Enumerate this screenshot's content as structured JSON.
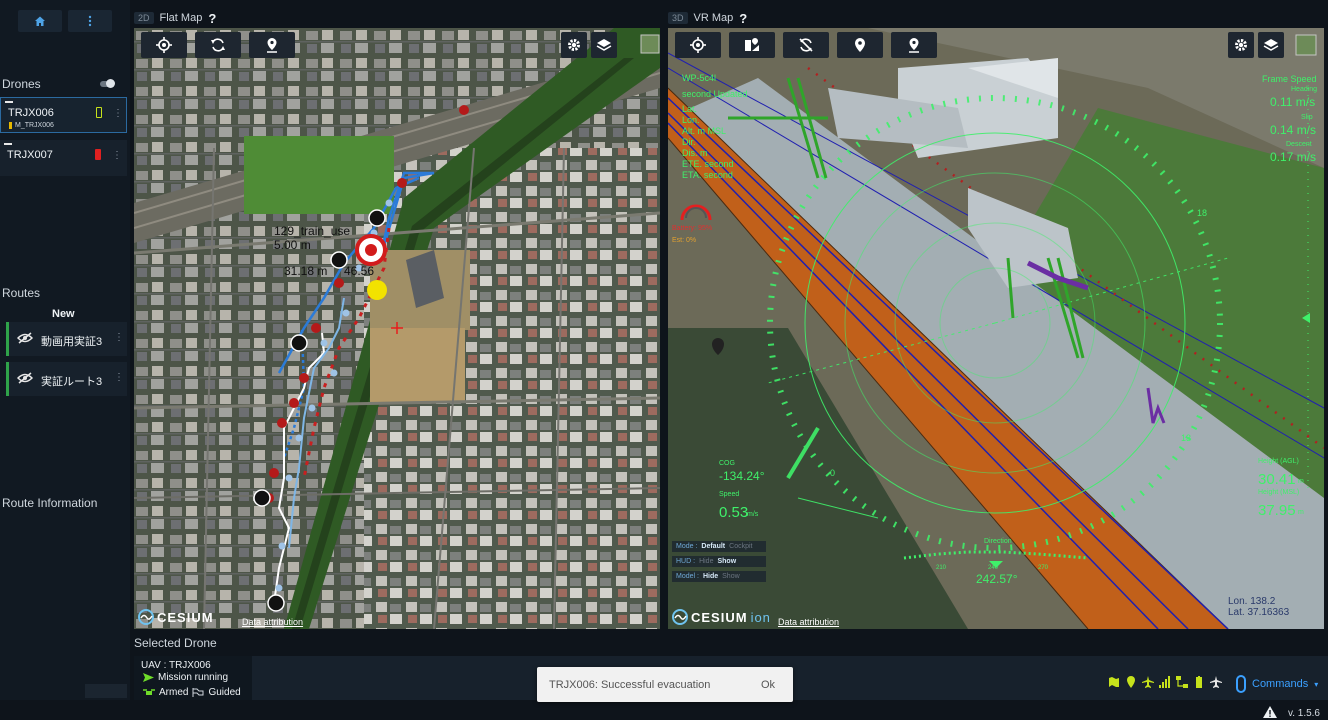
{
  "sidebar": {
    "drones_title": "Drones",
    "drones": [
      {
        "name": "TRJX006",
        "sub": "M_TRJX006",
        "battery_color": "#c6e21b",
        "selected": true
      },
      {
        "name": "TRJX007",
        "sub": "",
        "battery_color": "#e02020",
        "selected": false
      }
    ],
    "routes_title": "Routes",
    "new_label": "New",
    "routes": [
      {
        "name": "動画用実証3"
      },
      {
        "name": "実証ルート3"
      }
    ],
    "route_info_title": "Route Information"
  },
  "flat_map": {
    "tag": "2D",
    "title": "Flat Map",
    "help": "?",
    "overlay_label_1": "129_train_use",
    "overlay_label_2": "5.00 m",
    "overlay_label_3": "31.18 m",
    "overlay_label_4": "46.56",
    "cesium": "CESIUM",
    "attribution": "Data attribution"
  },
  "vr_map": {
    "tag": "3D",
    "title": "VR Map",
    "help": "?",
    "cesium": "CESIUM",
    "cesium_ion": "ion",
    "attribution": "Data attribution",
    "hud": {
      "wp": "WP-5c4l",
      "updated": "second Updated",
      "fields": [
        "Lat.",
        "Lon.",
        "Alt. m MSL",
        "Dir.",
        "Dis. m",
        "ETE. second",
        "ETA. second"
      ],
      "battery": "Battery: 95%",
      "est": "Est: 0%",
      "frame_speed_label": "Frame Speed",
      "heading_label": "Heading",
      "heading_value": "0.11 m/s",
      "slip_label": "Slip",
      "slip_value": "0.14 m/s",
      "descent_label": "Descent",
      "descent_value": "0.17 m/s",
      "cog_label": "COG",
      "cog_value": "-134.24°",
      "speed_label": "Speed",
      "speed_value": "0.53",
      "speed_unit": "m/s",
      "height_agl_label": "Height (AGL)",
      "height_agl_value": "30.41",
      "height_agl_unit": "m",
      "height_msl_label": "Height (MSL)",
      "height_msl_value": "37.95",
      "height_msl_unit": "m",
      "direction_label": "Direction",
      "direction_value": "242.57°",
      "dir_tick_1": "210",
      "dir_tick_2": "240",
      "dir_tick_3": "270",
      "lon": "Lon. 138.2",
      "lat": "Lat. 37.16363",
      "ring_18": "18",
      "ring_13": "13",
      "ring_0": "0"
    },
    "modes": [
      {
        "label": "Mode :",
        "active": "Default",
        "inactive": "Cockpit"
      },
      {
        "label": "HUD :",
        "active": "Hide",
        "inactive": "Show"
      },
      {
        "label": "Model :",
        "active": "Hide",
        "inactive": "Show"
      }
    ]
  },
  "bottom": {
    "selected_drone_label": "Selected Drone",
    "uav": "UAV : TRJX006",
    "mission": "Mission running",
    "armed": "Armed",
    "guided": "Guided",
    "toast_message": "TRJX006: Successful evacuation",
    "toast_ok": "Ok",
    "commands": "Commands",
    "version": "v. 1.5.6"
  },
  "colors": {
    "accent": "#3ba0ff",
    "hud_green": "#3ff06a",
    "route_green": "#2fa34a"
  }
}
